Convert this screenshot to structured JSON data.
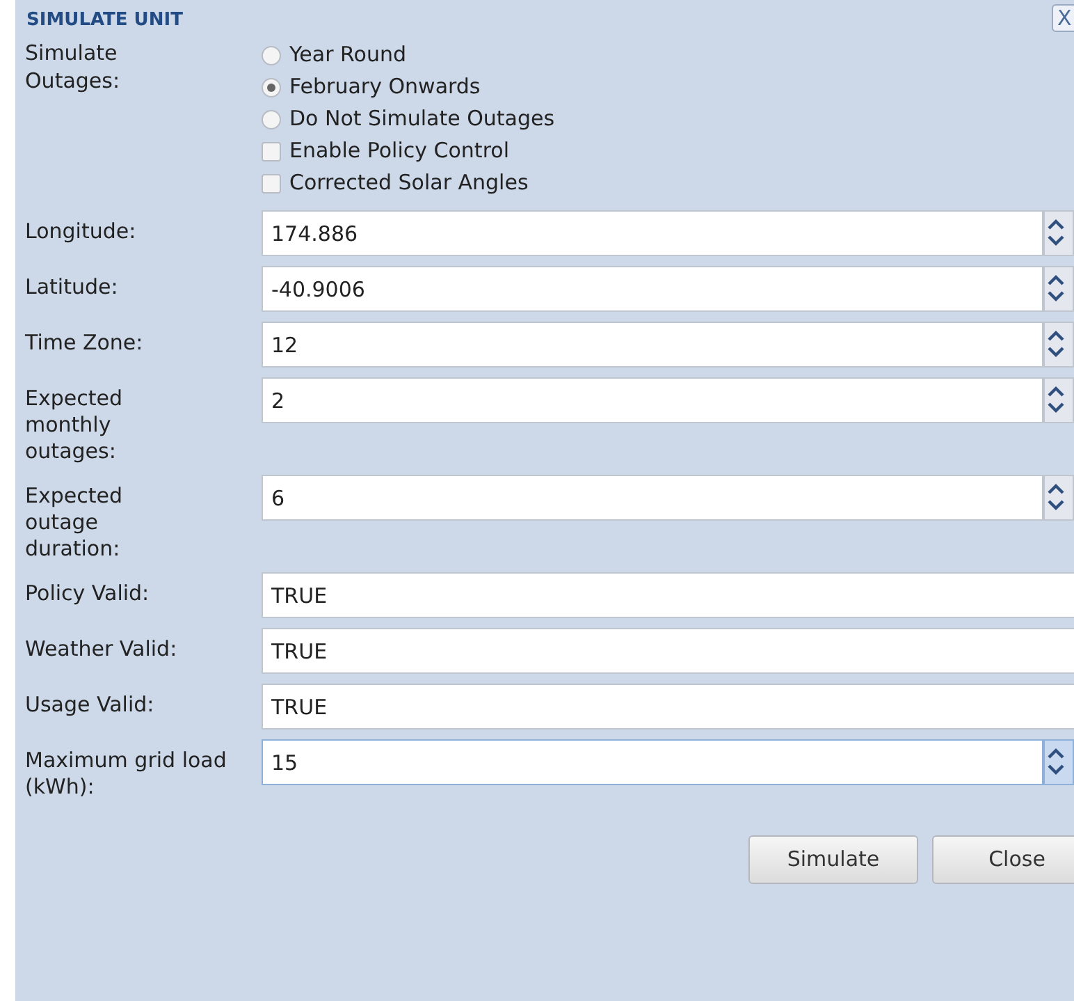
{
  "dialog": {
    "title": "SIMULATE UNIT",
    "close": "X"
  },
  "outages": {
    "label": "Simulate Outages:",
    "options": [
      {
        "kind": "radio",
        "label": "Year Round",
        "selected": false
      },
      {
        "kind": "radio",
        "label": "February Onwards",
        "selected": true
      },
      {
        "kind": "radio",
        "label": "Do Not Simulate Outages",
        "selected": false
      },
      {
        "kind": "checkbox",
        "label": "Enable Policy Control",
        "checked": false
      },
      {
        "kind": "checkbox",
        "label": "Corrected Solar Angles",
        "checked": false
      }
    ]
  },
  "fields": [
    {
      "kind": "spinner",
      "label": "Longitude:",
      "value": "174.886",
      "focused": false
    },
    {
      "kind": "spinner",
      "label": "Latitude:",
      "value": "-40.9006",
      "focused": false
    },
    {
      "kind": "spinner",
      "label": "Time Zone:",
      "value": "12",
      "focused": false
    },
    {
      "kind": "spinner",
      "label": "Expected monthly outages:",
      "value": "2",
      "focused": false
    },
    {
      "kind": "spinner",
      "label": "Expected outage duration:",
      "value": "6",
      "focused": false
    },
    {
      "kind": "text",
      "label": "Policy Valid:",
      "value": "TRUE",
      "focused": false
    },
    {
      "kind": "text",
      "label": "Weather Valid:",
      "value": "TRUE",
      "focused": false
    },
    {
      "kind": "text",
      "label": "Usage Valid:",
      "value": "TRUE",
      "focused": false
    },
    {
      "kind": "spinner",
      "label": "Maximum grid load (kWh):",
      "value": "15",
      "focused": true
    }
  ],
  "buttons": [
    "Simulate",
    "Close"
  ]
}
